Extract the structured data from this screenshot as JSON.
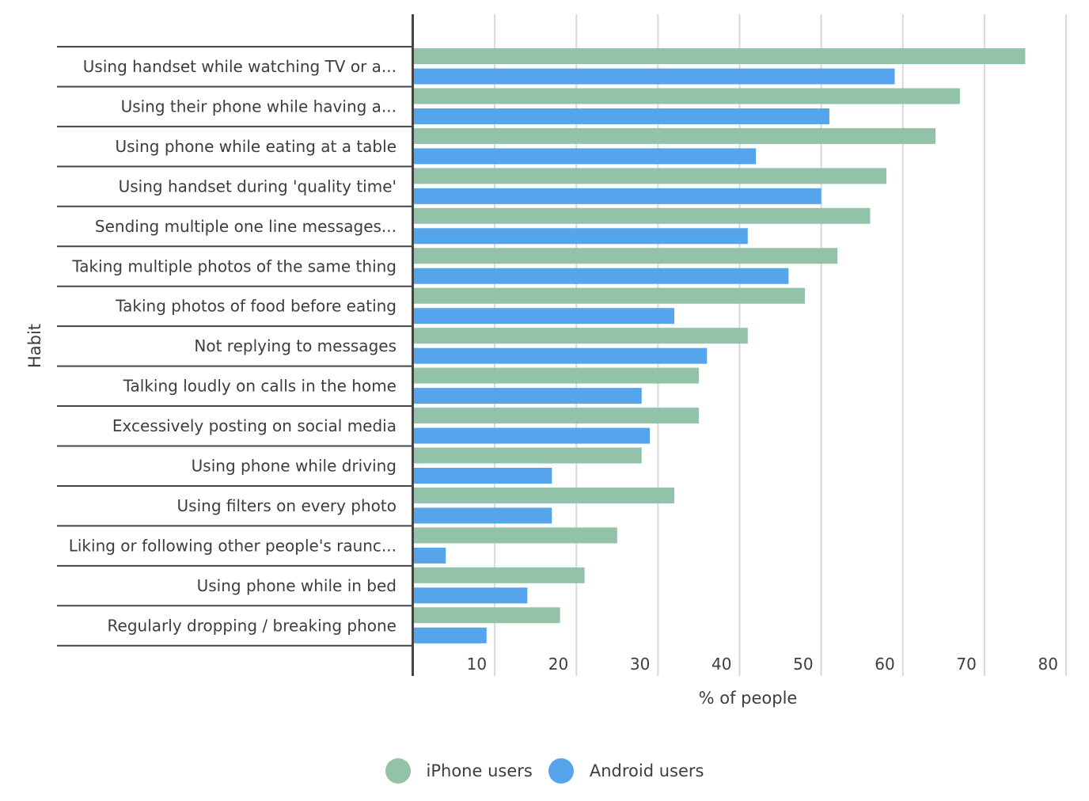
{
  "chart_data": {
    "type": "bar",
    "orientation": "horizontal",
    "title": "",
    "xlabel": "% of people",
    "ylabel": "Habit",
    "xlim": [
      0,
      80
    ],
    "xticks": [
      10,
      20,
      30,
      40,
      50,
      60,
      70,
      80
    ],
    "grid": true,
    "legend_position": "bottom",
    "categories": [
      "Using handset while watching TV or a...",
      "Using their phone while having a...",
      "Using phone while eating at a table",
      "Using handset during 'quality time'",
      "Sending multiple one line messages...",
      "Taking multiple photos of the same thing",
      "Taking photos of food before eating",
      "Not replying to messages",
      "Talking loudly on calls in the home",
      "Excessively posting on social media",
      "Using phone while driving",
      "Using filters on every photo",
      "Liking or following other people's raunc...",
      "Using phone while in bed",
      "Regularly dropping / breaking phone"
    ],
    "series": [
      {
        "name": "iPhone users",
        "color": "#92c3a8",
        "values": [
          75,
          67,
          64,
          58,
          56,
          52,
          48,
          41,
          35,
          35,
          28,
          32,
          25,
          21,
          18
        ]
      },
      {
        "name": "Android users",
        "color": "#56a4ec",
        "values": [
          59,
          51,
          42,
          50,
          41,
          46,
          32,
          36,
          28,
          29,
          17,
          17,
          4,
          14,
          9
        ]
      }
    ]
  }
}
